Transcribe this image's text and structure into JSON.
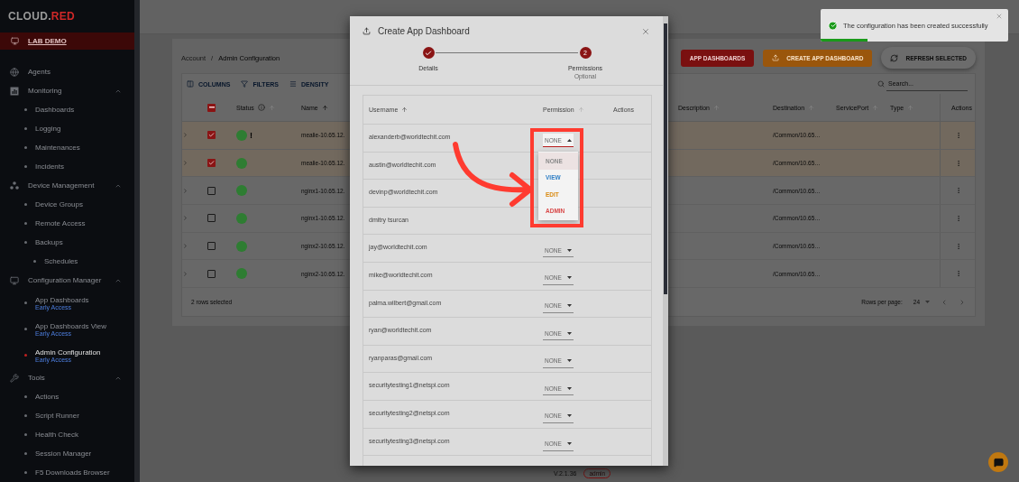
{
  "sidebar": {
    "logo": {
      "text": "CLOUD.",
      "accent": "RED"
    },
    "workspace": "LAB DEMO",
    "items": [
      {
        "label": "Agents",
        "kind": "agents"
      },
      {
        "label": "Monitoring",
        "kind": "monitoring",
        "expanded": true,
        "children": [
          {
            "label": "Dashboards",
            "selected": false
          },
          {
            "label": "Logging",
            "selected": false
          },
          {
            "label": "Maintenances",
            "selected": false
          },
          {
            "label": "Incidents",
            "selected": false
          }
        ]
      },
      {
        "label": "Device Management",
        "kind": "devices",
        "expanded": true,
        "children": [
          {
            "label": "Device Groups",
            "selected": false
          },
          {
            "label": "Remote Access",
            "selected": false
          },
          {
            "label": "Backups",
            "selected": false,
            "children": [
              {
                "label": "Schedules",
                "selected": false
              }
            ]
          }
        ]
      },
      {
        "label": "Configuration Manager",
        "kind": "config",
        "expanded": true,
        "children": [
          {
            "label": "App Dashboards",
            "note": "Early Access",
            "selected": false
          },
          {
            "label": "App Dashboards View",
            "note": "Early Access",
            "selected": false
          },
          {
            "label": "Admin Configuration",
            "note": "Early Access",
            "selected": true
          }
        ]
      },
      {
        "label": "Tools",
        "kind": "tools",
        "expanded": true,
        "children": [
          {
            "label": "Actions",
            "selected": false
          },
          {
            "label": "Script Runner",
            "selected": false
          },
          {
            "label": "Health Check",
            "selected": false
          },
          {
            "label": "Session Manager",
            "selected": false
          },
          {
            "label": "F5 Downloads Browser",
            "selected": false
          }
        ]
      }
    ]
  },
  "page": {
    "breadcrumb": [
      "Account",
      "Admin Configuration"
    ],
    "breadcrumb_separator": "/",
    "buttons": [
      {
        "label": "APP DASHBOARDS",
        "kind": "primary"
      },
      {
        "label": "CREATE APP DASHBOARD",
        "kind": "create"
      },
      {
        "label": "REFRESH SELECTED",
        "kind": "refresh"
      }
    ],
    "toolbar": [
      {
        "label": "COLUMNS",
        "kind": "columns"
      },
      {
        "label": "FILTERS",
        "kind": "filters"
      },
      {
        "label": "DENSITY",
        "kind": "density"
      }
    ],
    "search": {
      "placeholder": "Search..."
    },
    "select_all": {
      "indeterminate": true
    },
    "columns": [
      {
        "label": "Status",
        "sorted": false
      },
      {
        "label": "Name",
        "sorted": true
      },
      {
        "label": "Description",
        "sorted": false
      },
      {
        "label": "Destination",
        "sorted": false
      },
      {
        "label": "ServicePort",
        "sorted": false
      },
      {
        "label": "Type",
        "sorted": false
      },
      {
        "label": "Actions"
      }
    ],
    "rows": [
      {
        "selected": true,
        "alert": "!",
        "name": "mealie-10.65.12.",
        "destination": "/Common/10.65…"
      },
      {
        "selected": true,
        "name": "mealie-10.65.12.",
        "destination": "/Common/10.65…"
      },
      {
        "selected": false,
        "name": "nginx1-10.65.12.",
        "destination": "/Common/10.65…"
      },
      {
        "selected": false,
        "name": "nginx1-10.65.12.",
        "destination": "/Common/10.65…"
      },
      {
        "selected": false,
        "name": "nginx2-10.65.12.",
        "destination": "/Common/10.65…"
      },
      {
        "selected": false,
        "name": "nginx2-10.65.12.",
        "destination": "/Common/10.65…"
      }
    ],
    "footer": {
      "selection": "2 rows selected",
      "rows_per_page_label": "Rows per page:",
      "rows_per_page": "24"
    },
    "version": "V.2.1.36",
    "role": "admin"
  },
  "modal": {
    "title": "Create App Dashboard",
    "steps": [
      {
        "label": "Details",
        "done": true
      },
      {
        "label": "Permissions",
        "done": false,
        "number": "2",
        "note": "Optional"
      }
    ],
    "columns": [
      "Username",
      "Permission",
      "Actions"
    ],
    "users": [
      {
        "username": "alexanderb@worldtechit.com",
        "permission": "NONE",
        "open": true
      },
      {
        "username": "austin@worldtechit.com"
      },
      {
        "username": "devinp@worldtechit.com"
      },
      {
        "username": "dmitry tsurcan"
      },
      {
        "username": "jay@worldtechit.com",
        "permission": "NONE",
        "open": false
      },
      {
        "username": "mike@worldtechit.com",
        "permission": "NONE",
        "open": false
      },
      {
        "username": "palma.wilbert@gmail.com",
        "permission": "NONE",
        "open": false
      },
      {
        "username": "ryan@worldtechit.com",
        "permission": "NONE",
        "open": false
      },
      {
        "username": "ryanparas@gmail.com",
        "permission": "NONE",
        "open": false
      },
      {
        "username": "securitytesting1@netspi.com",
        "permission": "NONE",
        "open": false
      },
      {
        "username": "securitytesting2@netspi.com",
        "permission": "NONE",
        "open": false
      },
      {
        "username": "securitytesting3@netspi.com",
        "permission": "NONE",
        "open": false
      }
    ],
    "menu": [
      {
        "label": "NONE",
        "selected": true,
        "color": "#8a8a8a"
      },
      {
        "label": "VIEW",
        "selected": false,
        "color": "#2f7fc6"
      },
      {
        "label": "EDIT",
        "selected": false,
        "color": "#d98a10"
      },
      {
        "label": "ADMIN",
        "selected": false,
        "color": "#d84848"
      }
    ]
  },
  "toast": {
    "message": "The configuration has been created successfully",
    "level": 0.25
  }
}
